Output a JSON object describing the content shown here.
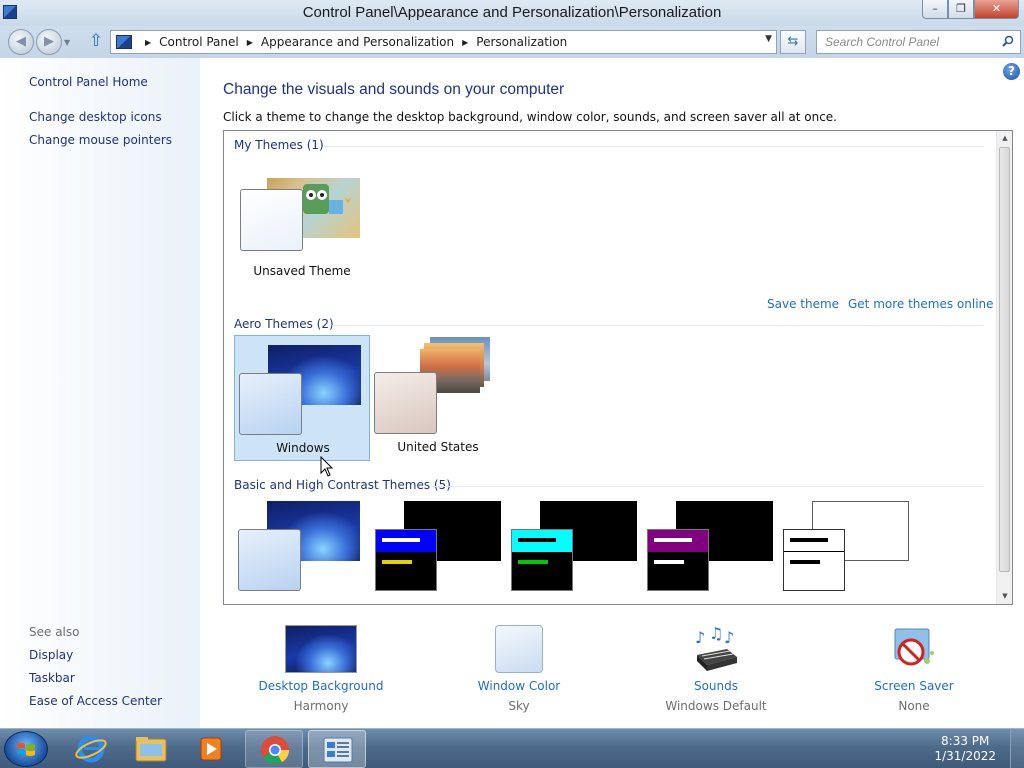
{
  "window": {
    "title": "Control Panel\\Appearance and Personalization\\Personalization",
    "minimize": "–",
    "restore": "❐",
    "close": "✕"
  },
  "address_bar": {
    "crumbs": [
      "Control Panel",
      "Appearance and Personalization",
      "Personalization"
    ],
    "search_placeholder": "Search Control Panel"
  },
  "left_pane": {
    "links": [
      "Control Panel Home",
      "Change desktop icons",
      "Change mouse pointers"
    ],
    "see_also_label": "See also",
    "see_also": [
      "Display",
      "Taskbar",
      "Ease of Access Center"
    ]
  },
  "main": {
    "help": "?",
    "heading": "Change the visuals and sounds on your computer",
    "subheading": "Click a theme to change the desktop background, window color, sounds, and screen saver all at once.",
    "sections": {
      "my_themes": "My Themes (1)",
      "aero_themes": "Aero Themes (2)",
      "basic_themes": "Basic and High Contrast Themes (5)"
    },
    "my_themes": [
      {
        "name": "Unsaved Theme"
      }
    ],
    "aero_themes": [
      {
        "name": "Windows",
        "selected": true
      },
      {
        "name": "United States",
        "selected": false
      }
    ],
    "save_theme": "Save theme",
    "get_more_themes": "Get more themes online",
    "basic_theme_colors": [
      {
        "bar": "#0000ff",
        "line1": "#ffffff",
        "line2": "#e6d000"
      },
      {
        "bar": "#00ffff",
        "line1": "#000000",
        "line2": "#00c800"
      },
      {
        "bar": "#800080",
        "line1": "#ffffff",
        "line2": "#ffffff"
      },
      {
        "bar": "#ffffff",
        "line1": "#000000",
        "line2": "#000000"
      }
    ]
  },
  "settings": [
    {
      "label": "Desktop Background",
      "value": "Harmony",
      "icon": "desktop-background-icon"
    },
    {
      "label": "Window Color",
      "value": "Sky",
      "icon": "window-color-icon"
    },
    {
      "label": "Sounds",
      "value": "Windows Default",
      "icon": "sounds-icon"
    },
    {
      "label": "Screen Saver",
      "value": "None",
      "icon": "screen-saver-icon"
    }
  ],
  "taskbar": {
    "apps": [
      "internet-explorer-icon",
      "windows-explorer-icon",
      "media-player-icon",
      "chrome-icon",
      "control-panel-icon"
    ],
    "time": "8:33 PM",
    "date": "1/31/2022"
  }
}
